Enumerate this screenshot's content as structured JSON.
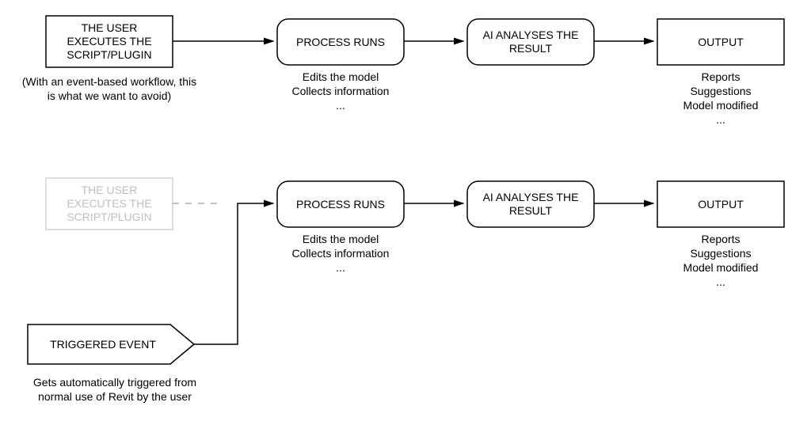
{
  "flow1": {
    "user": {
      "line1": "THE USER",
      "line2": "EXECUTES THE",
      "line3": "SCRIPT/PLUGIN"
    },
    "user_caption": {
      "line1": "(With an event-based workflow, this",
      "line2": "is what we want to avoid)"
    },
    "process": {
      "label": "PROCESS RUNS"
    },
    "process_caption": {
      "line1": "Edits the model",
      "line2": "Collects information",
      "line3": "..."
    },
    "ai": {
      "line1": "AI ANALYSES THE",
      "line2": "RESULT"
    },
    "output": {
      "label": "OUTPUT"
    },
    "output_caption": {
      "line1": "Reports",
      "line2": "Suggestions",
      "line3": "Model modified",
      "line4": "..."
    }
  },
  "flow2": {
    "user": {
      "line1": "THE USER",
      "line2": "EXECUTES THE",
      "line3": "SCRIPT/PLUGIN"
    },
    "process": {
      "label": "PROCESS RUNS"
    },
    "process_caption": {
      "line1": "Edits the model",
      "line2": "Collects information",
      "line3": "..."
    },
    "ai": {
      "line1": "AI ANALYSES THE",
      "line2": "RESULT"
    },
    "output": {
      "label": "OUTPUT"
    },
    "output_caption": {
      "line1": "Reports",
      "line2": "Suggestions",
      "line3": "Model modified",
      "line4": "..."
    },
    "event": {
      "label": "TRIGGERED EVENT"
    },
    "event_caption": {
      "line1": "Gets automatically triggered from",
      "line2": "normal use of Revit by the user"
    }
  }
}
